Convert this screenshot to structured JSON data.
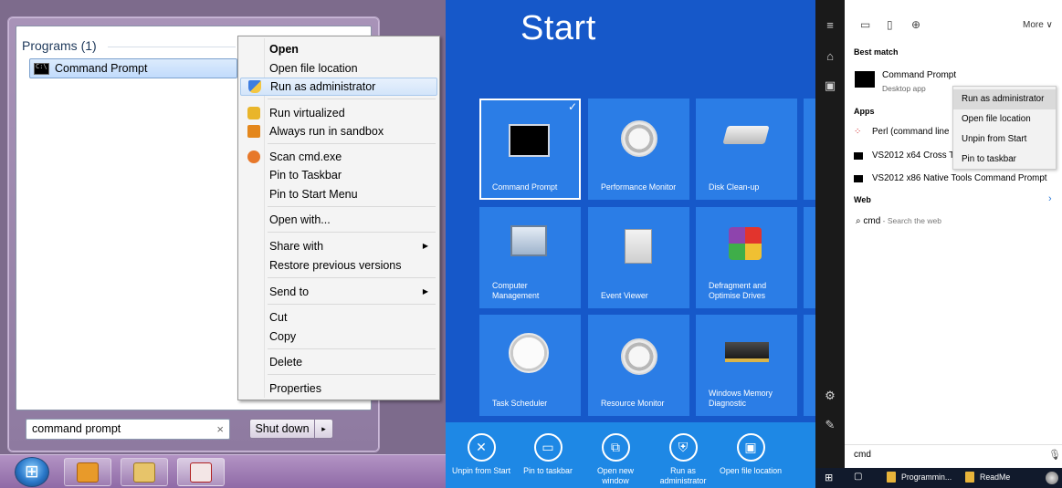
{
  "win7": {
    "programs_header": "Programs (1)",
    "result_item": "Command Prompt",
    "search_value": "command prompt",
    "search_clear": "×",
    "shutdown_label": "Shut down",
    "shutdown_arrow": "▸",
    "context_menu": {
      "open": "Open",
      "open_file_location": "Open file location",
      "run_as_admin": "Run as administrator",
      "run_virtualized": "Run virtualized",
      "always_run_in_sandbox": "Always run in sandbox",
      "scan": "Scan cmd.exe",
      "pin_taskbar": "Pin to Taskbar",
      "pin_start": "Pin to Start Menu",
      "open_with": "Open with...",
      "share_with": "Share with",
      "restore_previous": "Restore previous versions",
      "send_to": "Send to",
      "cut": "Cut",
      "copy": "Copy",
      "delete": "Delete",
      "properties": "Properties",
      "submenu_arrow": "▶"
    }
  },
  "win8": {
    "title": "Start",
    "check": "✓",
    "tiles": {
      "command_prompt": "Command Prompt",
      "performance_monitor": "Performance Monitor",
      "disk_cleanup": "Disk Clean-up",
      "computer_management": "Computer Management",
      "event_viewer": "Event Viewer",
      "defragment": "Defragment and Optimise Drives",
      "task_scheduler": "Task Scheduler",
      "resource_monitor": "Resource Monitor",
      "memory_diagnostic": "Windows Memory Diagnostic"
    },
    "appbar": {
      "unpin": "Unpin from Start",
      "pin_taskbar": "Pin to taskbar",
      "open_new_window": "Open new window",
      "run_as_admin": "Run as administrator",
      "open_file_location": "Open file location"
    }
  },
  "win10": {
    "more": "More ∨",
    "best_match_header": "Best match",
    "best_match_name": "Command Prompt",
    "best_match_sub": "Desktop app",
    "apps_header": "Apps",
    "apps": [
      "Perl (command line",
      "VS2012 x64 Cross T",
      "VS2012 x86 Native Tools Command Prompt"
    ],
    "web_header": "Web",
    "web_query": "cmd",
    "web_sub": " - Search the web",
    "context_menu": [
      "Run as administrator",
      "Open file location",
      "Unpin from Start",
      "Pin to taskbar"
    ],
    "search_value": "cmd",
    "taskbar": {
      "item1": "Programmin...",
      "item2": "ReadMe"
    }
  },
  "colors": {
    "win7_highlight": "#c1dbfc",
    "win8_background": "#1658c9",
    "win8_tile": "#2b7de6",
    "win8_appbar": "#1e88e5",
    "win10_rail": "#1a1a1a",
    "win10_context_highlight": "#dadada"
  }
}
